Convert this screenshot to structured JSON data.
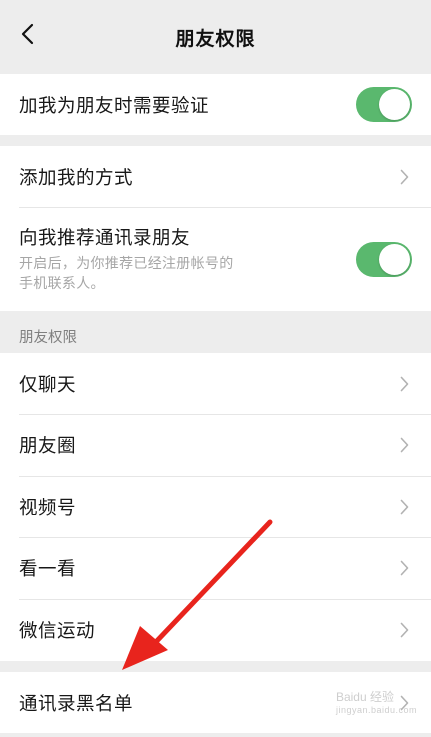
{
  "navbar": {
    "title": "朋友权限",
    "back_icon": "chevron-left-icon"
  },
  "verify_row": {
    "label": "加我为朋友时需要验证",
    "toggle_on": true
  },
  "add_methods_row": {
    "label": "添加我的方式"
  },
  "recommend_row": {
    "label": "向我推荐通讯录朋友",
    "description_line1": "开启后，为你推荐已经注册帐号的",
    "description_line2": "手机联系人。",
    "toggle_on": true
  },
  "permissions_section": {
    "header": "朋友权限",
    "items": [
      {
        "label": "仅聊天"
      },
      {
        "label": "朋友圈"
      },
      {
        "label": "视频号"
      },
      {
        "label": "看一看"
      },
      {
        "label": "微信运动"
      }
    ]
  },
  "blacklist_row": {
    "label": "通讯录黑名单"
  },
  "watermark": {
    "text": "Baidu 经验",
    "sub": "jingyan.baidu.com"
  },
  "colors": {
    "toggle_green": "#5ab86e",
    "arrow_red": "#e8241d",
    "background": "#ededed"
  }
}
